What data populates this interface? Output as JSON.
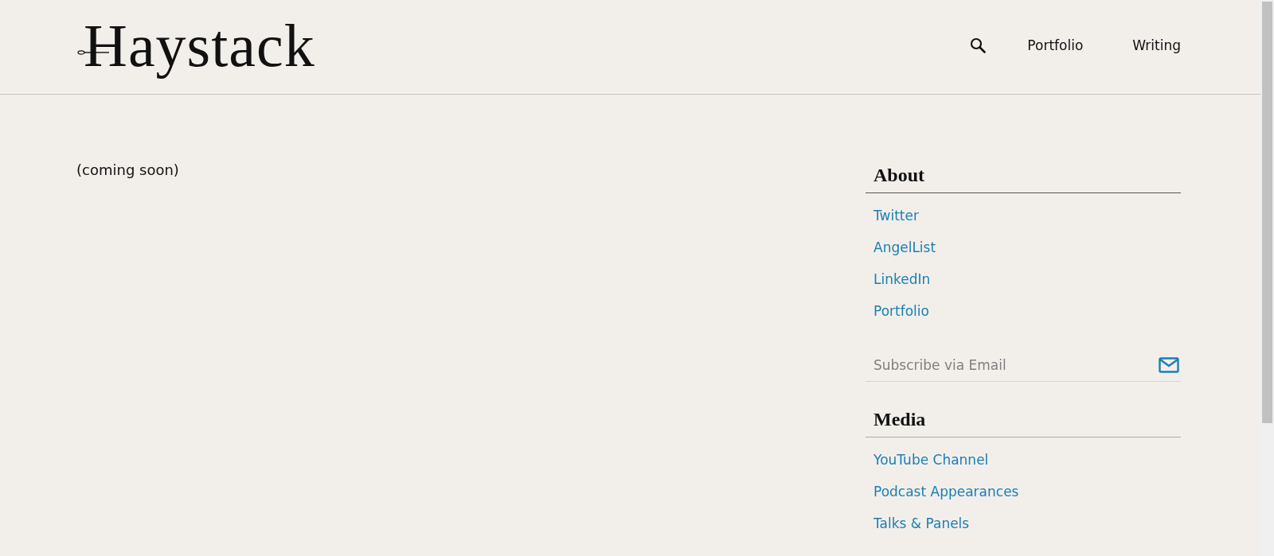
{
  "header": {
    "logo": "Haystack",
    "nav": [
      "Portfolio",
      "Writing"
    ]
  },
  "main": {
    "text": "(coming soon)"
  },
  "sidebar": {
    "sections": [
      {
        "title": "About",
        "links": [
          "Twitter",
          "AngelList",
          "LinkedIn",
          "Portfolio"
        ],
        "subscribe": {
          "placeholder": "Subscribe via Email"
        }
      },
      {
        "title": "Media",
        "links": [
          "YouTube Channel",
          "Podcast Appearances",
          "Talks & Panels"
        ]
      }
    ]
  }
}
